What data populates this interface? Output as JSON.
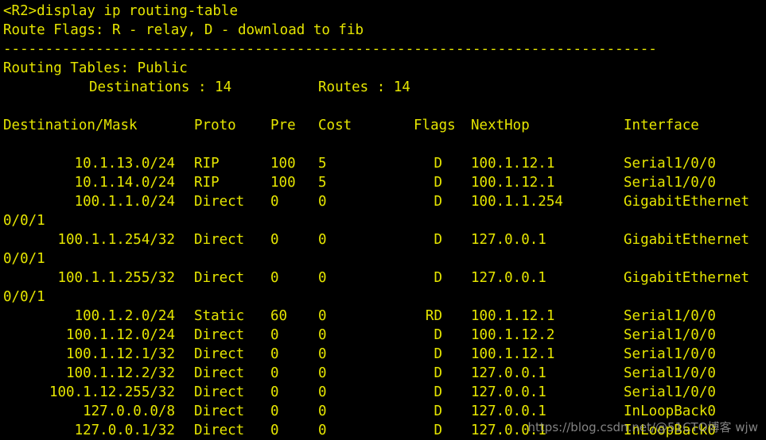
{
  "command": "<R2>display ip routing-table",
  "flags_legend": "Route Flags: R - relay, D - download to fib",
  "separator": "------------------------------------------------------------------------------",
  "table_title": "Routing Tables: Public",
  "destinations_label": "Destinations : 14",
  "routes_label": "Routes : 14",
  "headers": {
    "destination": "Destination/Mask",
    "proto": "Proto",
    "pre": "Pre",
    "cost": "Cost",
    "flags": "Flags",
    "nexthop": "NextHop",
    "interface": "Interface"
  },
  "rows": [
    {
      "dest": "10.1.13.0/24",
      "proto": "RIP",
      "pre": "100",
      "cost": "5",
      "flags": "D",
      "nexthop": "100.1.12.1",
      "iface": "Serial1/0/0",
      "wrap": ""
    },
    {
      "dest": "10.1.14.0/24",
      "proto": "RIP",
      "pre": "100",
      "cost": "5",
      "flags": "D",
      "nexthop": "100.1.12.1",
      "iface": "Serial1/0/0",
      "wrap": ""
    },
    {
      "dest": "100.1.1.0/24",
      "proto": "Direct",
      "pre": "0",
      "cost": "0",
      "flags": "D",
      "nexthop": "100.1.1.254",
      "iface": "GigabitEthernet",
      "wrap": "0/0/1"
    },
    {
      "dest": "100.1.1.254/32",
      "proto": "Direct",
      "pre": "0",
      "cost": "0",
      "flags": "D",
      "nexthop": "127.0.0.1",
      "iface": "GigabitEthernet",
      "wrap": "0/0/1"
    },
    {
      "dest": "100.1.1.255/32",
      "proto": "Direct",
      "pre": "0",
      "cost": "0",
      "flags": "D",
      "nexthop": "127.0.0.1",
      "iface": "GigabitEthernet",
      "wrap": "0/0/1"
    },
    {
      "dest": "100.1.2.0/24",
      "proto": "Static",
      "pre": "60",
      "cost": "0",
      "flags": "RD",
      "nexthop": "100.1.12.1",
      "iface": "Serial1/0/0",
      "wrap": ""
    },
    {
      "dest": "100.1.12.0/24",
      "proto": "Direct",
      "pre": "0",
      "cost": "0",
      "flags": "D",
      "nexthop": "100.1.12.2",
      "iface": "Serial1/0/0",
      "wrap": ""
    },
    {
      "dest": "100.1.12.1/32",
      "proto": "Direct",
      "pre": "0",
      "cost": "0",
      "flags": "D",
      "nexthop": "100.1.12.1",
      "iface": "Serial1/0/0",
      "wrap": ""
    },
    {
      "dest": "100.1.12.2/32",
      "proto": "Direct",
      "pre": "0",
      "cost": "0",
      "flags": "D",
      "nexthop": "127.0.0.1",
      "iface": "Serial1/0/0",
      "wrap": ""
    },
    {
      "dest": "100.1.12.255/32",
      "proto": "Direct",
      "pre": "0",
      "cost": "0",
      "flags": "D",
      "nexthop": "127.0.0.1",
      "iface": "Serial1/0/0",
      "wrap": ""
    },
    {
      "dest": "127.0.0.0/8",
      "proto": "Direct",
      "pre": "0",
      "cost": "0",
      "flags": "D",
      "nexthop": "127.0.0.1",
      "iface": "InLoopBack0",
      "wrap": ""
    },
    {
      "dest": "127.0.0.1/32",
      "proto": "Direct",
      "pre": "0",
      "cost": "0",
      "flags": "D",
      "nexthop": "127.0.0.1",
      "iface": "InLoopBack0",
      "wrap": ""
    }
  ],
  "watermark": "https://blog.csdn.net/@51CTO博客 wjw",
  "colors": {
    "background": "#000000",
    "text": "#e5e500"
  }
}
